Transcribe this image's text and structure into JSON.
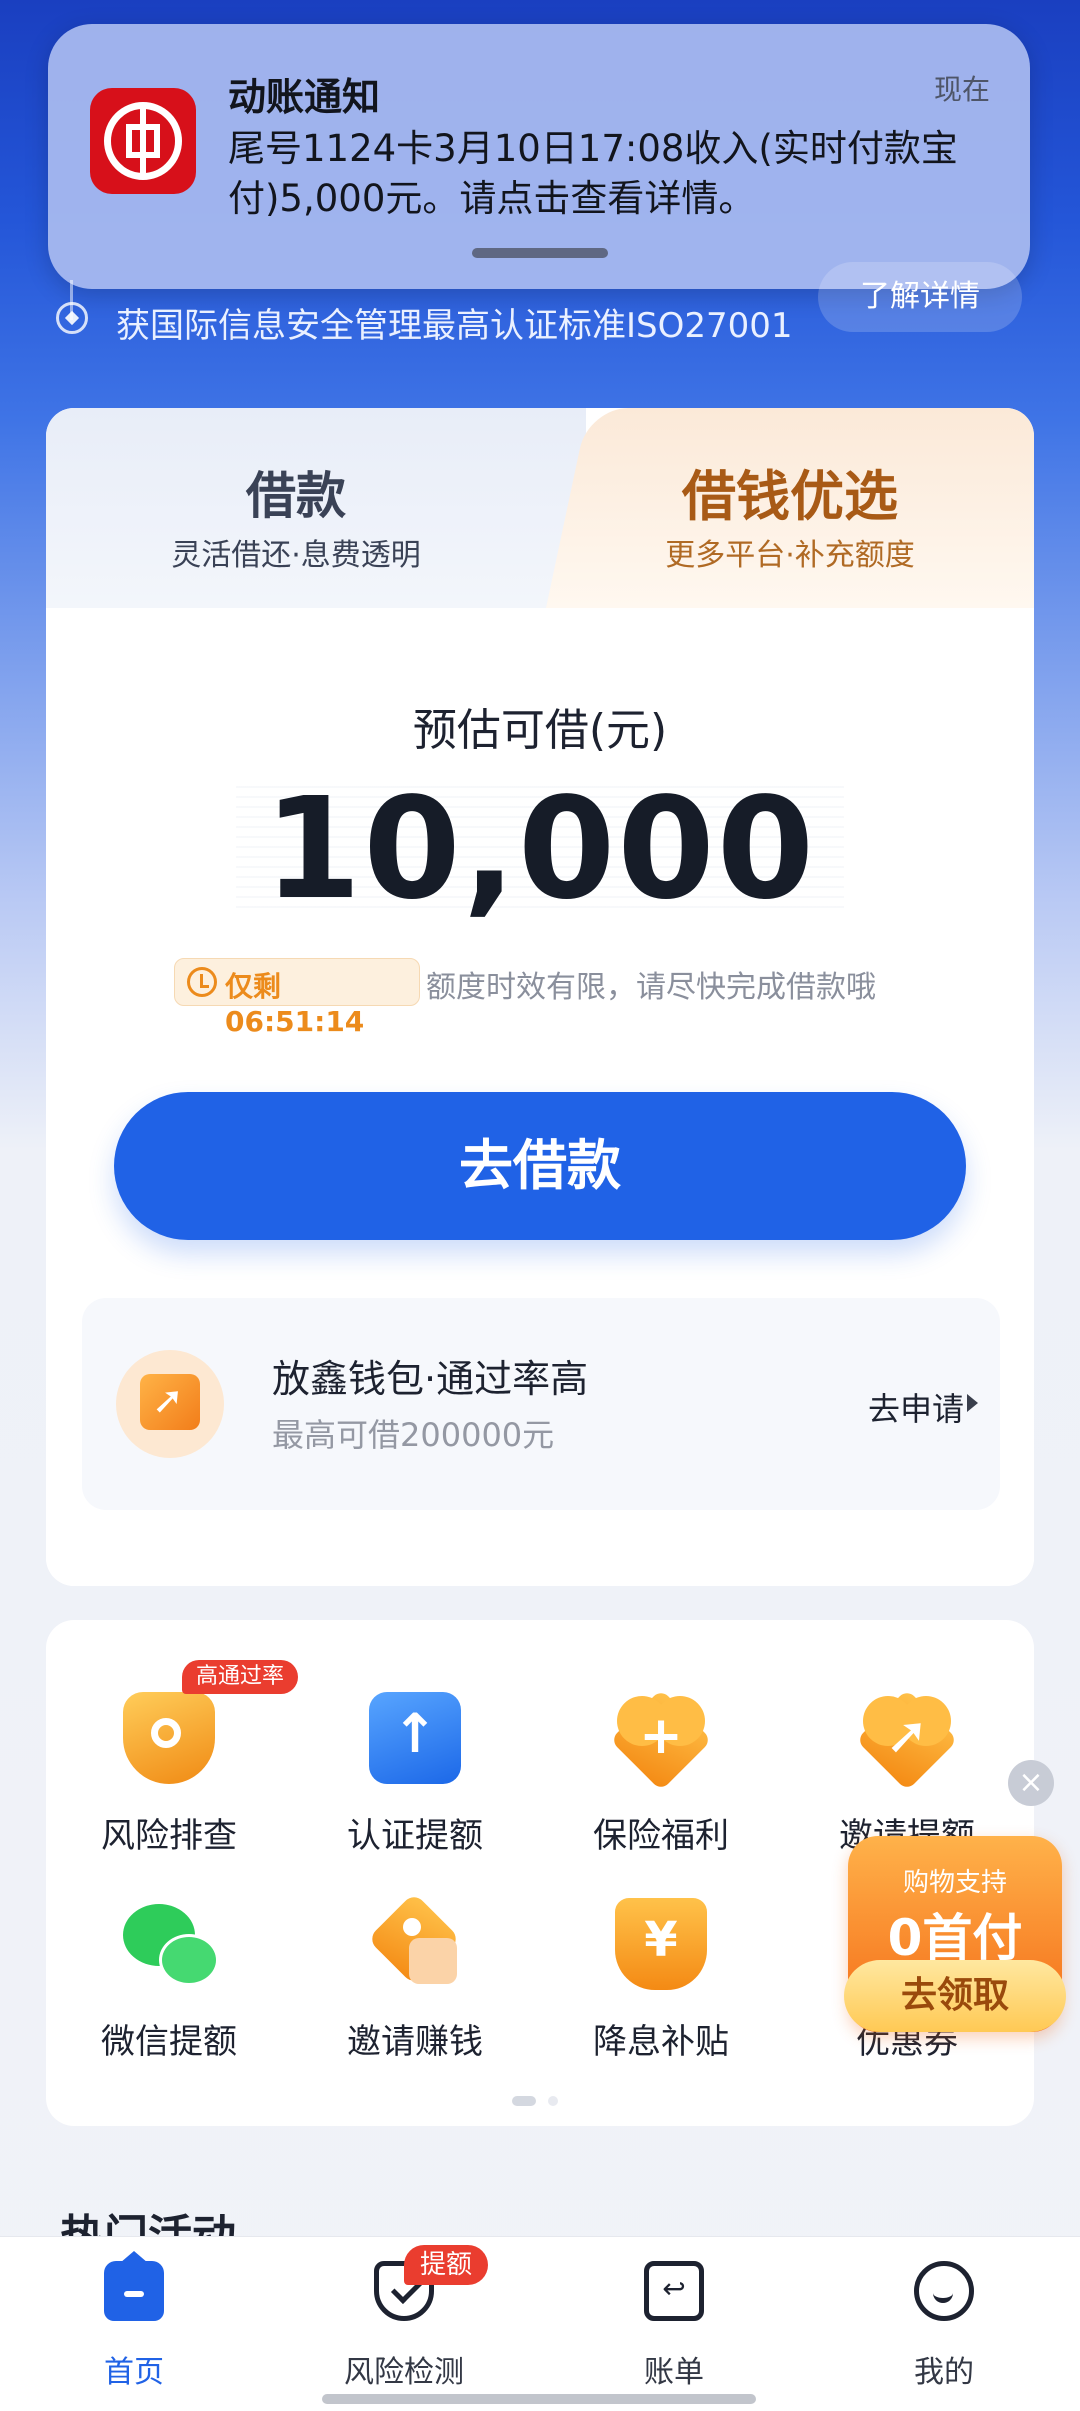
{
  "notification": {
    "title": "动账通知",
    "time": "现在",
    "body": "尾号1124卡3月10日17:08收入(实时付款宝付)5,000元。请点击查看详情。",
    "app_icon": "bank-logo-icon"
  },
  "security": {
    "text": "获国际信息安全管理最高认证标准ISO27001",
    "learn_more": "了解详情"
  },
  "loan_tabs": {
    "left": {
      "title": "借款",
      "subtitle": "灵活借还·息费透明"
    },
    "right": {
      "title": "借钱优选",
      "subtitle": "更多平台·补充额度"
    }
  },
  "loan": {
    "estimate_label": "预估可借(元)",
    "amount": "10,000",
    "countdown": "仅剩06:51:14",
    "countdown_desc": "额度时效有限，请尽快完成借款哦",
    "borrow_button": "去借款"
  },
  "promo": {
    "title": "放鑫钱包·通过率高",
    "subtitle": "最高可借200000元",
    "action": "去申请"
  },
  "services": {
    "badge": "高通过率",
    "items": [
      {
        "label": "风险排查",
        "icon": "shield-search-icon"
      },
      {
        "label": "认证提额",
        "icon": "upload-arrow-icon"
      },
      {
        "label": "保险福利",
        "icon": "heart-plus-icon"
      },
      {
        "label": "邀请提额",
        "icon": "heart-arrow-icon"
      },
      {
        "label": "微信提额",
        "icon": "wechat-icon"
      },
      {
        "label": "邀请赚钱",
        "icon": "invite-tag-icon"
      },
      {
        "label": "降息补贴",
        "icon": "yuan-down-icon"
      },
      {
        "label": "优惠券",
        "icon": "coupon-icon"
      }
    ]
  },
  "floating_promo": {
    "top_text": "购物支持",
    "big_text": "0首付",
    "button": "去领取",
    "close": "×"
  },
  "section": {
    "title": "热门活动"
  },
  "bottom_nav": {
    "items": [
      {
        "label": "首页",
        "icon": "home-icon",
        "active": true
      },
      {
        "label": "风险检测",
        "icon": "shield-check-icon",
        "badge": "提额"
      },
      {
        "label": "账单",
        "icon": "bill-icon"
      },
      {
        "label": "我的",
        "icon": "profile-icon"
      }
    ]
  },
  "colors": {
    "primary": "#2062e6",
    "accent_orange": "#ec8b1c",
    "badge_red": "#ea3d2f"
  }
}
